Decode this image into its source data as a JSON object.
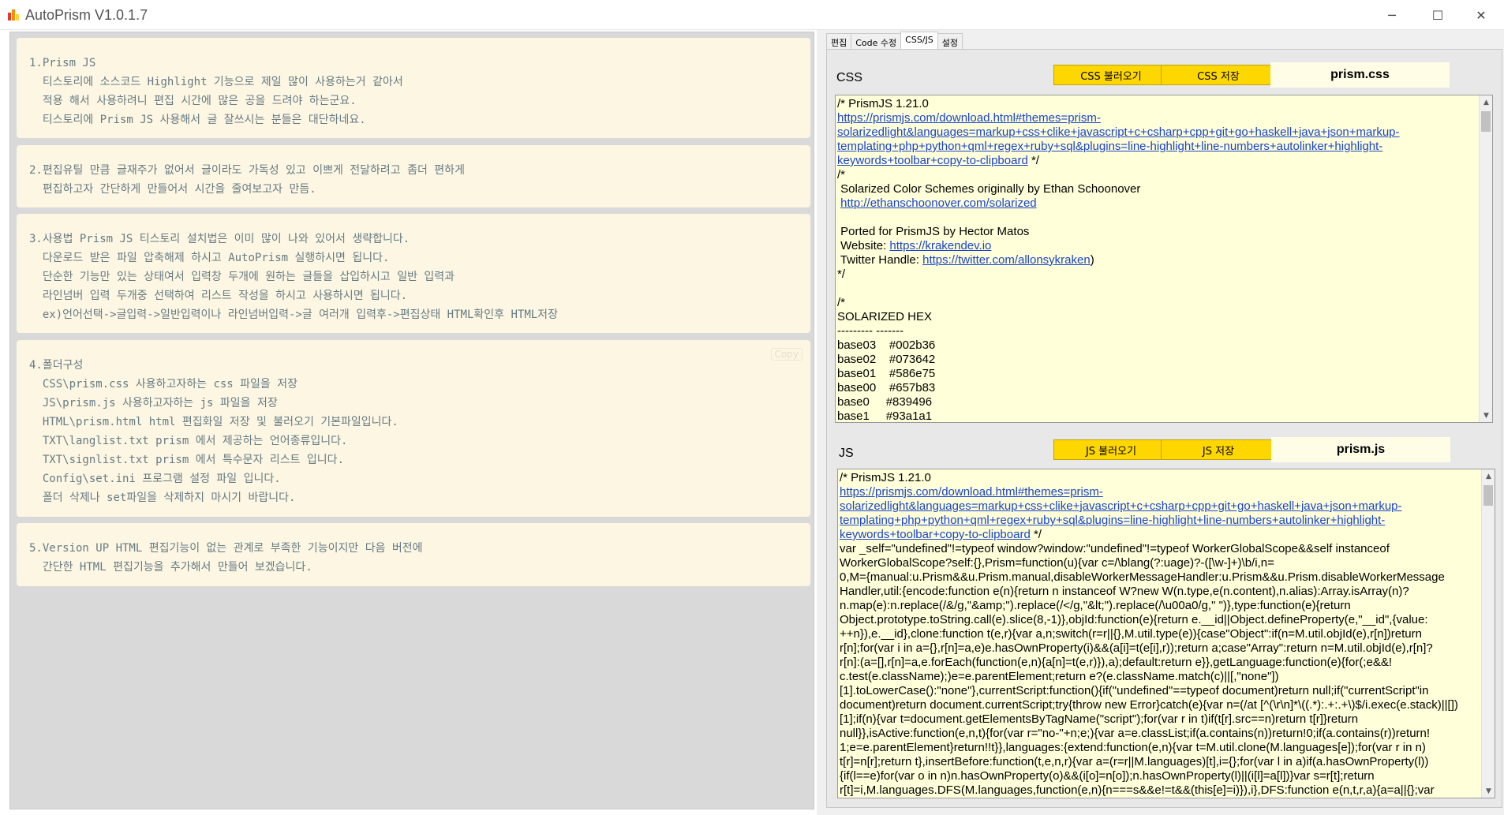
{
  "window": {
    "title": "AutoPrism V1.0.1.7",
    "minimize_glyph": "─",
    "maximize_glyph": "☐",
    "close_glyph": "✕"
  },
  "left": {
    "cards": [
      {
        "lines": [
          "1.Prism JS",
          "  티스토리에 소스코드 Highlight 기능으로 제일 많이 사용하는거 같아서",
          "  적용 해서 사용하려니 편집 시간에 많은 공을 드려야 하는군요.",
          "  티스토리에 Prism JS 사용해서 글 잘쓰시는 분들은 대단하네요."
        ]
      },
      {
        "lines": [
          "2.편집유틸 만큼 글재주가 없어서 글이라도 가독성 있고 이쁘게 전달하려고 좀더 편하게",
          "  편집하고자 간단하게 만들어서 시간을 줄여보고자 만듬."
        ]
      },
      {
        "lines": [
          "3.사용법 Prism JS 티스토리 설치법은 이미 많이 나와 있어서 생략합니다.",
          "  다운로드 받은 파일 압축해제 하시고 AutoPrism 실행하시면 됩니다.",
          "  단순한 기능만 있는 상태여서 입력창 두개에 원하는 글들을 삽입하시고 일반 입력과",
          "  라인넘버 입력 두개중 선택하여 리스트 작성을 하시고 사용하시면 됩니다.",
          "  ex)언어선택->글입력->일반입력이나 라인넘버입력->글 여러개 입력후->편집상태 HTML확인후 HTML저장"
        ]
      },
      {
        "copy_label": "Copy",
        "lines": [
          "4.폴더구성",
          "  CSS\\prism.css 사용하고자하는 css 파일을 저장",
          "  JS\\prism.js 사용하고자하는 js 파일을 저장",
          "  HTML\\prism.html html 편집화일 저장 및 불러오기 기본파일입니다.",
          "  TXT\\langlist.txt prism 에서 제공하는 언어종류입니다.",
          "  TXT\\signlist.txt prism 에서 특수문자 리스트 입니다.",
          "  Config\\set.ini 프로그램 설정 파일 입니다.",
          "  폴더 삭제나 set파일을 삭제하지 마시기 바랍니다."
        ]
      },
      {
        "lines": [
          "5.Version UP HTML 편집기능이 없는 관계로 부족한 기능이지만 다음 버전에",
          "  간단한 HTML 편집기능을 추가해서 만들어 보겠습니다."
        ]
      }
    ]
  },
  "tabs": [
    {
      "label": "편집",
      "active": false
    },
    {
      "label": "Code 수정",
      "active": false
    },
    {
      "label": "CSS/JS",
      "active": true
    },
    {
      "label": "설정",
      "active": false
    }
  ],
  "css_section": {
    "label": "CSS",
    "load_button": "CSS 불러오기",
    "save_button": "CSS 저장",
    "filename": "prism.css",
    "lines": [
      {
        "text": "/* PrismJS 1.21.0"
      },
      {
        "link": "https://prismjs.com/download.html#themes=prism-"
      },
      {
        "link": "solarizedlight&languages=markup+css+clike+javascript+c+csharp+cpp+git+go+haskell+java+json+markup-"
      },
      {
        "link": "templating+php+python+qml+regex+ruby+sql&plugins=line-highlight+line-numbers+autolinker+highlight-"
      },
      {
        "link": "keywords+toolbar+copy-to-clipboard",
        "after": " */"
      },
      {
        "text": "/*"
      },
      {
        "text": " Solarized Color Schemes originally by Ethan Schoonover"
      },
      {
        "text": " ",
        "link": "http://ethanschoonover.com/solarized"
      },
      {
        "text": ""
      },
      {
        "text": " Ported for PrismJS by Hector Matos"
      },
      {
        "text": " Website: ",
        "link": "https://krakendev.io"
      },
      {
        "text": " Twitter Handle: ",
        "link": "https://twitter.com/allonsykraken",
        "after": ")"
      },
      {
        "text": "*/"
      },
      {
        "text": ""
      },
      {
        "text": "/*"
      },
      {
        "text": "SOLARIZED HEX"
      },
      {
        "text": "--------- -------"
      },
      {
        "text": "base03    #002b36"
      },
      {
        "text": "base02    #073642"
      },
      {
        "text": "base01    #586e75"
      },
      {
        "text": "base00    #657b83"
      },
      {
        "text": "base0     #839496"
      },
      {
        "text": "base1     #93a1a1"
      }
    ]
  },
  "js_section": {
    "label": "JS",
    "load_button": "JS 불러오기",
    "save_button": "JS 저장",
    "filename": "prism.js",
    "lines": [
      {
        "text": "/* PrismJS 1.21.0"
      },
      {
        "link": "https://prismjs.com/download.html#themes=prism-"
      },
      {
        "link": "solarizedlight&languages=markup+css+clike+javascript+c+csharp+cpp+git+go+haskell+java+json+markup-"
      },
      {
        "link": "templating+php+python+qml+regex+ruby+sql&plugins=line-highlight+line-numbers+autolinker+highlight-"
      },
      {
        "link": "keywords+toolbar+copy-to-clipboard",
        "after": " */"
      },
      {
        "text": "var _self=\"undefined\"!=typeof window?window:\"undefined\"!=typeof WorkerGlobalScope&&self instanceof"
      },
      {
        "text": "WorkerGlobalScope?self:{},Prism=function(u){var c=/\\blang(?:uage)?-([\\w-]+)\\b/i,n="
      },
      {
        "text": "0,M={manual:u.Prism&&u.Prism.manual,disableWorkerMessageHandler:u.Prism&&u.Prism.disableWorkerMessage"
      },
      {
        "text": "Handler,util:{encode:function e(n){return n instanceof W?new W(n.type,e(n.content),n.alias):Array.isArray(n)?"
      },
      {
        "text": "n.map(e):n.replace(/&/g,\"&amp;\").replace(/</g,\"&lt;\").replace(/\\u00a0/g,\" \")},type:function(e){return"
      },
      {
        "text": "Object.prototype.toString.call(e).slice(8,-1)},objId:function(e){return e.__id||Object.defineProperty(e,\"__id\",{value:"
      },
      {
        "text": "++n}),e.__id},clone:function t(e,r){var a,n;switch(r=r||{},M.util.type(e)){case\"Object\":if(n=M.util.objId(e),r[n])return"
      },
      {
        "text": "r[n];for(var i in a={},r[n]=a,e)e.hasOwnProperty(i)&&(a[i]=t(e[i],r));return a;case\"Array\":return n=M.util.objId(e),r[n]?"
      },
      {
        "text": "r[n]:(a=[],r[n]=a,e.forEach(function(e,n){a[n]=t(e,r)}),a);default:return e}},getLanguage:function(e){for(;e&&!"
      },
      {
        "text": "c.test(e.className);)e=e.parentElement;return e?(e.className.match(c)||[,\"none\"])"
      },
      {
        "text": "[1].toLowerCase():\"none\"},currentScript:function(){if(\"undefined\"==typeof document)return null;if(\"currentScript\"in"
      },
      {
        "text": "document)return document.currentScript;try{throw new Error}catch(e){var n=(/at [^(\\r\\n]*\\((.*):.+:.+\\)$/i.exec(e.stack)||[])"
      },
      {
        "text": "[1];if(n){var t=document.getElementsByTagName(\"script\");for(var r in t)if(t[r].src==n)return t[r]}return"
      },
      {
        "text": "null}},isActive:function(e,n,t){for(var r=\"no-\"+n;e;){var a=e.classList;if(a.contains(n))return!0;if(a.contains(r))return!"
      },
      {
        "text": "1;e=e.parentElement}return!!t}},languages:{extend:function(e,n){var t=M.util.clone(M.languages[e]);for(var r in n)"
      },
      {
        "text": "t[r]=n[r];return t},insertBefore:function(t,e,n,r){var a=(r=r||M.languages)[t],i={};for(var l in a)if(a.hasOwnProperty(l))"
      },
      {
        "text": "{if(l==e)for(var o in n)n.hasOwnProperty(o)&&(i[o]=n[o]);n.hasOwnProperty(l)||(i[l]=a[l])}var s=r[t];return"
      },
      {
        "text": "r[t]=i,M.languages.DFS(M.languages,function(e,n){n===s&&e!=t&&(this[e]=i)}),i},DFS:function e(n,t,r,a){a=a||{};var"
      }
    ]
  },
  "scroll": {
    "up": "▲",
    "down": "▼"
  }
}
